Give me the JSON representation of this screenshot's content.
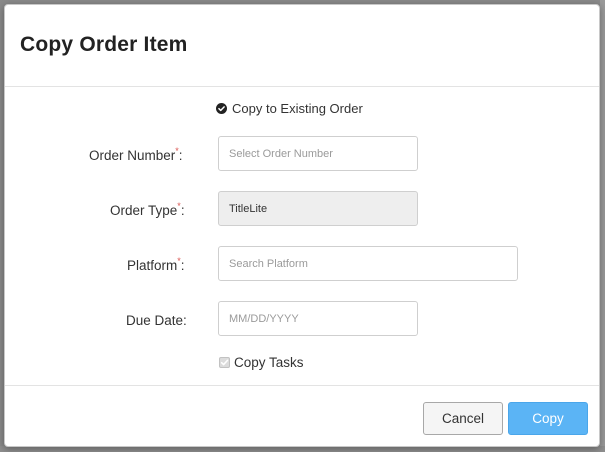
{
  "modal": {
    "title": "Copy Order Item"
  },
  "mode": {
    "label": "Copy to Existing Order"
  },
  "form": {
    "order_number": {
      "label": "Order Number",
      "required_mark": "*",
      "colon": ":",
      "placeholder": "Select Order Number"
    },
    "order_type": {
      "label": "Order Type",
      "required_mark": "*",
      "colon": ":",
      "value": "TitleLite"
    },
    "platform": {
      "label": "Platform",
      "required_mark": "*",
      "colon": ":",
      "placeholder": "Search Platform"
    },
    "due_date": {
      "label": "Due Date:",
      "placeholder": "MM/DD/YYYY"
    },
    "copy_tasks": {
      "label": "Copy Tasks",
      "checked": true
    }
  },
  "footer": {
    "cancel_label": "Cancel",
    "copy_label": "Copy"
  },
  "colors": {
    "primary": "#5bb4f5",
    "required": "#d9534f"
  }
}
